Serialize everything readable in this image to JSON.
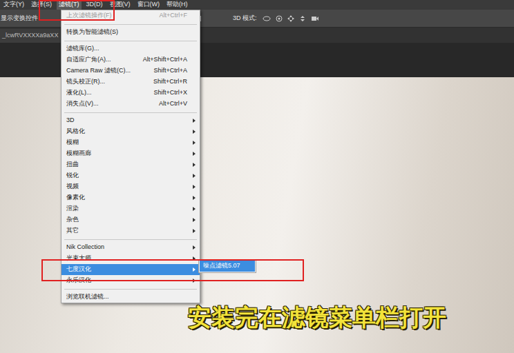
{
  "menubar": {
    "items": [
      {
        "label": "文字(Y)",
        "selected": false
      },
      {
        "label": "选择(S)",
        "selected": false
      },
      {
        "label": "滤镜(T)",
        "selected": true
      },
      {
        "label": "3D(D)",
        "selected": false
      },
      {
        "label": "视图(V)",
        "selected": false
      },
      {
        "label": "窗口(W)",
        "selected": false
      },
      {
        "label": "帮助(H)",
        "selected": false
      }
    ]
  },
  "options_bar": {
    "label": "显示变换控件",
    "mode_label": "3D 模式:"
  },
  "document_tab": {
    "title": "_lcwRVXXXXa9aXX"
  },
  "filter_menu": {
    "items": [
      {
        "kind": "item",
        "label": "上次滤镜操作(F)",
        "shortcut": "Alt+Ctrl+F",
        "disabled": true,
        "selected": false,
        "has_submenu": false
      },
      {
        "kind": "separator"
      },
      {
        "kind": "item",
        "label": "转换为智能滤镜(S)",
        "shortcut": "",
        "disabled": false,
        "selected": false,
        "has_submenu": false
      },
      {
        "kind": "separator"
      },
      {
        "kind": "item",
        "label": "滤镜库(G)...",
        "shortcut": "",
        "disabled": false,
        "selected": false,
        "has_submenu": false
      },
      {
        "kind": "item",
        "label": "自适应广角(A)...",
        "shortcut": "Alt+Shift+Ctrl+A",
        "disabled": false,
        "selected": false,
        "has_submenu": false
      },
      {
        "kind": "item",
        "label": "Camera Raw 滤镜(C)...",
        "shortcut": "Shift+Ctrl+A",
        "disabled": false,
        "selected": false,
        "has_submenu": false
      },
      {
        "kind": "item",
        "label": "镜头校正(R)...",
        "shortcut": "Shift+Ctrl+R",
        "disabled": false,
        "selected": false,
        "has_submenu": false
      },
      {
        "kind": "item",
        "label": "液化(L)...",
        "shortcut": "Shift+Ctrl+X",
        "disabled": false,
        "selected": false,
        "has_submenu": false
      },
      {
        "kind": "item",
        "label": "消失点(V)...",
        "shortcut": "Alt+Ctrl+V",
        "disabled": false,
        "selected": false,
        "has_submenu": false
      },
      {
        "kind": "separator"
      },
      {
        "kind": "item",
        "label": "3D",
        "shortcut": "",
        "disabled": false,
        "selected": false,
        "has_submenu": true
      },
      {
        "kind": "item",
        "label": "风格化",
        "shortcut": "",
        "disabled": false,
        "selected": false,
        "has_submenu": true
      },
      {
        "kind": "item",
        "label": "模糊",
        "shortcut": "",
        "disabled": false,
        "selected": false,
        "has_submenu": true
      },
      {
        "kind": "item",
        "label": "模糊画廊",
        "shortcut": "",
        "disabled": false,
        "selected": false,
        "has_submenu": true
      },
      {
        "kind": "item",
        "label": "扭曲",
        "shortcut": "",
        "disabled": false,
        "selected": false,
        "has_submenu": true
      },
      {
        "kind": "item",
        "label": "锐化",
        "shortcut": "",
        "disabled": false,
        "selected": false,
        "has_submenu": true
      },
      {
        "kind": "item",
        "label": "视频",
        "shortcut": "",
        "disabled": false,
        "selected": false,
        "has_submenu": true
      },
      {
        "kind": "item",
        "label": "像素化",
        "shortcut": "",
        "disabled": false,
        "selected": false,
        "has_submenu": true
      },
      {
        "kind": "item",
        "label": "渲染",
        "shortcut": "",
        "disabled": false,
        "selected": false,
        "has_submenu": true
      },
      {
        "kind": "item",
        "label": "杂色",
        "shortcut": "",
        "disabled": false,
        "selected": false,
        "has_submenu": true
      },
      {
        "kind": "item",
        "label": "其它",
        "shortcut": "",
        "disabled": false,
        "selected": false,
        "has_submenu": true
      },
      {
        "kind": "separator"
      },
      {
        "kind": "item",
        "label": "Nik Collection",
        "shortcut": "",
        "disabled": false,
        "selected": false,
        "has_submenu": true
      },
      {
        "kind": "item",
        "label": "光束大师",
        "shortcut": "",
        "disabled": false,
        "selected": false,
        "has_submenu": true
      },
      {
        "kind": "item",
        "label": "七度汉化",
        "shortcut": "",
        "disabled": false,
        "selected": true,
        "has_submenu": true
      },
      {
        "kind": "item",
        "label": "永乐汉化",
        "shortcut": "",
        "disabled": false,
        "selected": false,
        "has_submenu": true
      },
      {
        "kind": "separator"
      },
      {
        "kind": "item",
        "label": "浏览联机滤镜...",
        "shortcut": "",
        "disabled": false,
        "selected": false,
        "has_submenu": false
      }
    ]
  },
  "submenu": {
    "items": [
      {
        "label": "噪点滤镜5.07",
        "selected": true
      }
    ]
  },
  "caption": "安装完在滤镜菜单栏打开"
}
